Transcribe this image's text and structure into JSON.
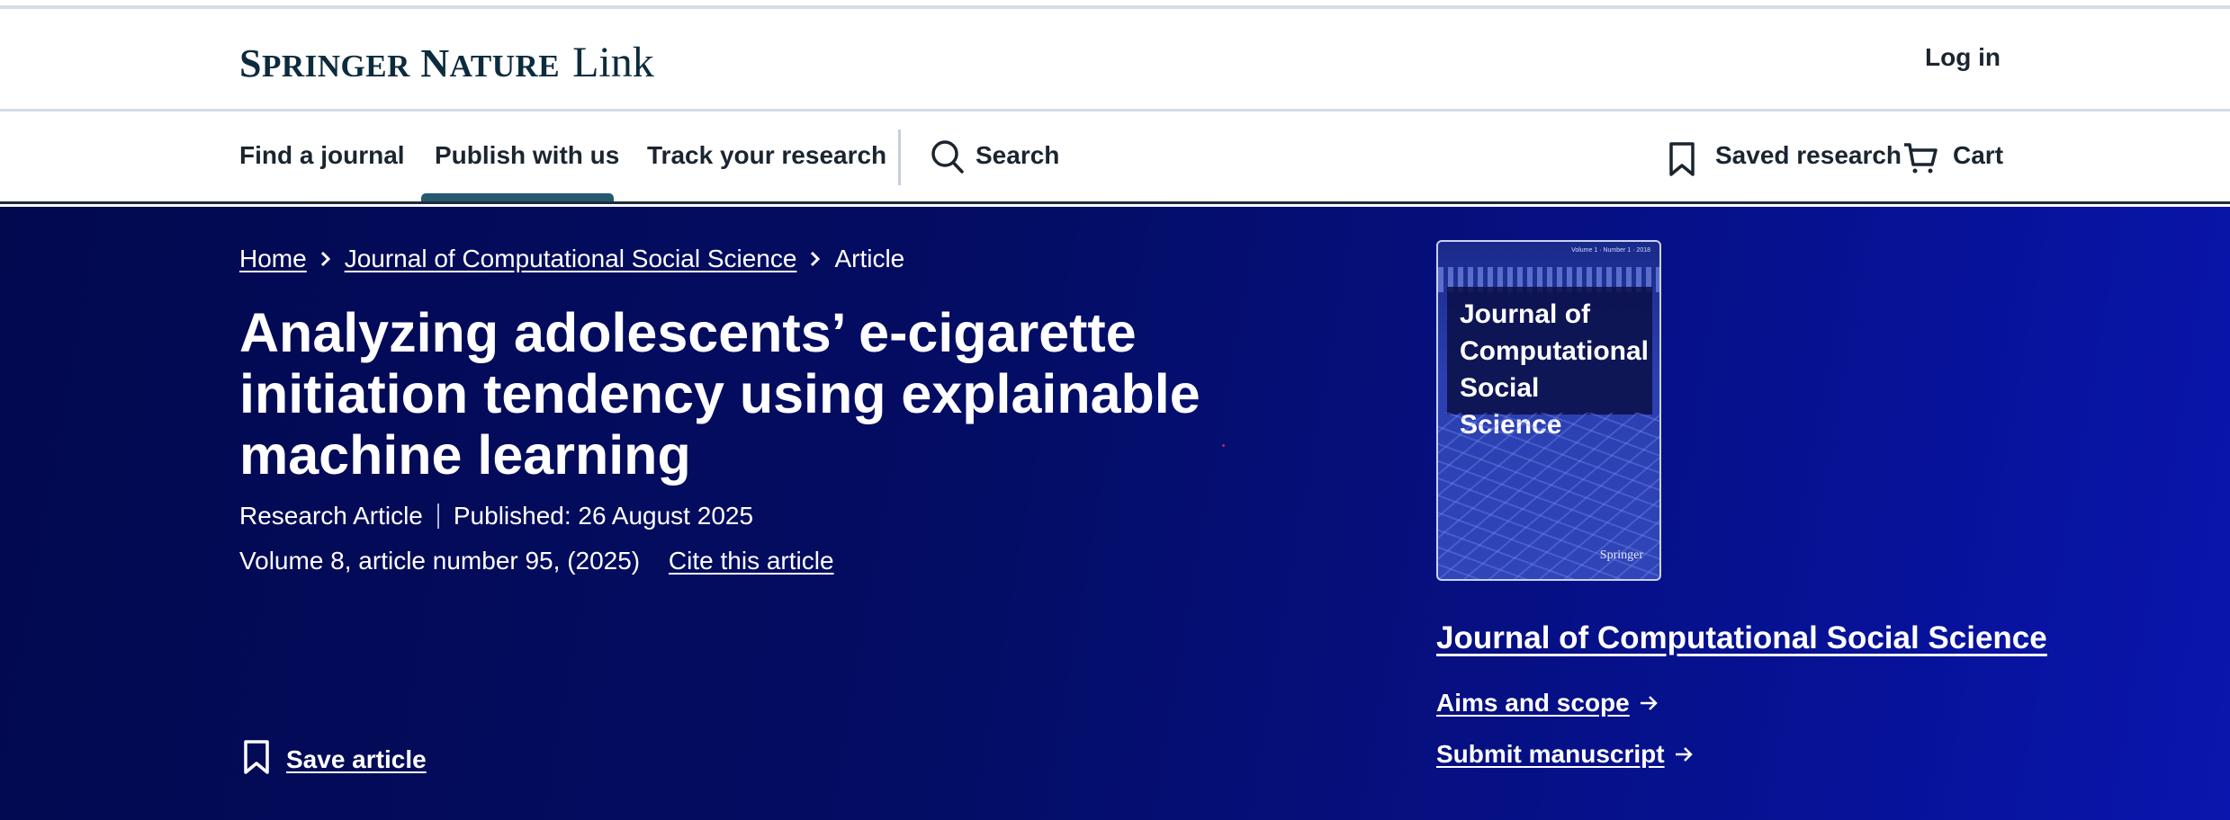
{
  "header": {
    "logo_brand_1": "S",
    "logo_brand_2": "PRINGER",
    "logo_brand_3": " N",
    "logo_brand_4": "ATURE",
    "logo_product": "Link",
    "login_label": "Log in"
  },
  "nav": {
    "find_journal": "Find a journal",
    "publish": "Publish with us",
    "track": "Track your research",
    "search": "Search",
    "saved": "Saved research",
    "cart": "Cart"
  },
  "breadcrumb": {
    "home": "Home",
    "journal": "Journal of Computational Social Science",
    "current": "Article"
  },
  "article": {
    "title": "Analyzing adolescents’ e-cigarette initiation tendency using explainable machine learning",
    "type": "Research Article",
    "published": "Published: 26 August 2025",
    "volume": "Volume 8, article number 95, (2025)",
    "cite_label": "Cite this article",
    "save_label": "Save article"
  },
  "journal": {
    "cover_title": "Journal of Computational Social Science",
    "cover_volume": "Volume 1 · Number 1 · 2018",
    "cover_publisher": "Springer",
    "name": "Journal of Computational Social Science",
    "aims_label": "Aims and scope",
    "submit_label": "Submit manuscript"
  },
  "colors": {
    "brand_dark": "#0c2b3d",
    "hero_start": "#02094f",
    "hero_end": "#0a16ad",
    "nav_active": "#25596e"
  }
}
